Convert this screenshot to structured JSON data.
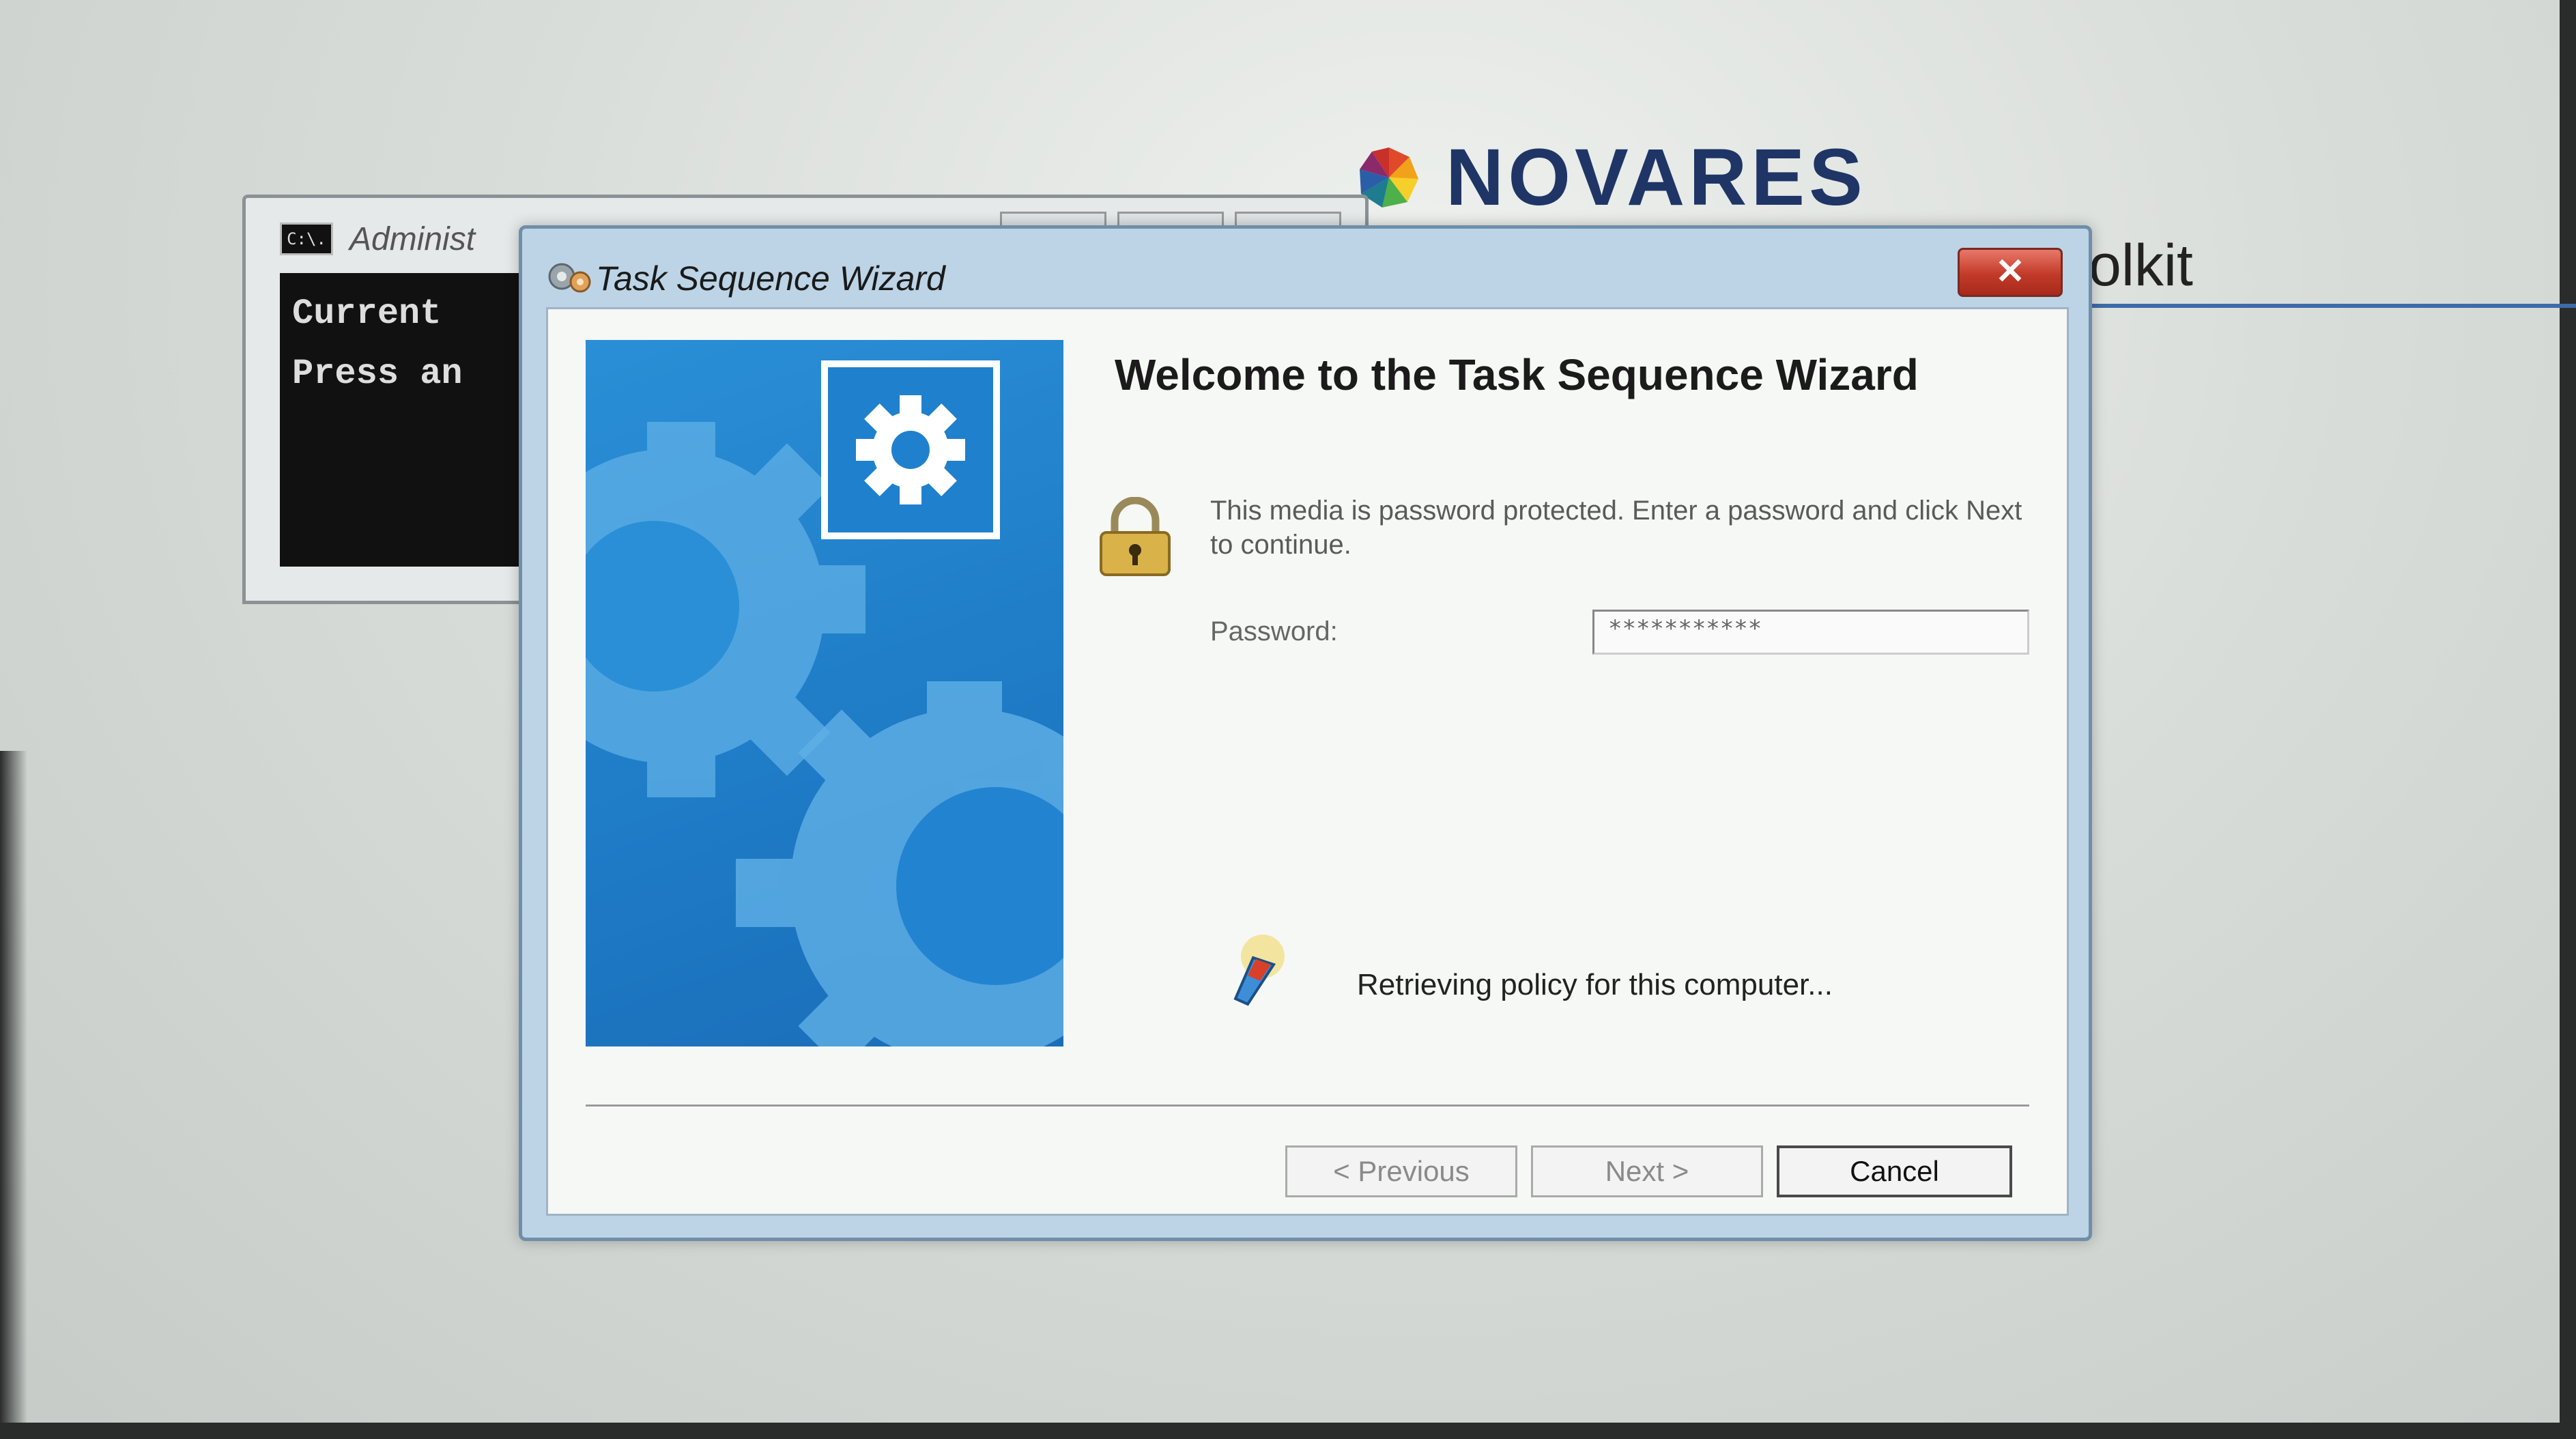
{
  "brand": {
    "name": "NOVARES",
    "subtitle_fragment": "olkit",
    "colors": {
      "text": "#1f3566",
      "accent": "#3d6ba8"
    }
  },
  "console": {
    "title": "Administ",
    "icon_label": "C:\\.",
    "lines": [
      "Current",
      "Press an"
    ]
  },
  "wizard": {
    "title": "Task Sequence Wizard",
    "close_glyph": "✕",
    "heading": "Welcome to the Task Sequence Wizard",
    "instructions": "This media is password protected.  Enter a password and click Next to continue.",
    "password_label": "Password:",
    "password_value": "***********",
    "status": "Retrieving policy for this computer...",
    "buttons": {
      "previous": "< Previous",
      "next": "Next >",
      "cancel": "Cancel"
    },
    "icons": [
      "task-sequence-icon",
      "gear-icon",
      "lock-icon",
      "policy-retrieval-icon",
      "close-icon"
    ],
    "colors": {
      "banner": "#1f80cd",
      "close": "#c23a28",
      "frame": "#bcd4e6"
    }
  }
}
